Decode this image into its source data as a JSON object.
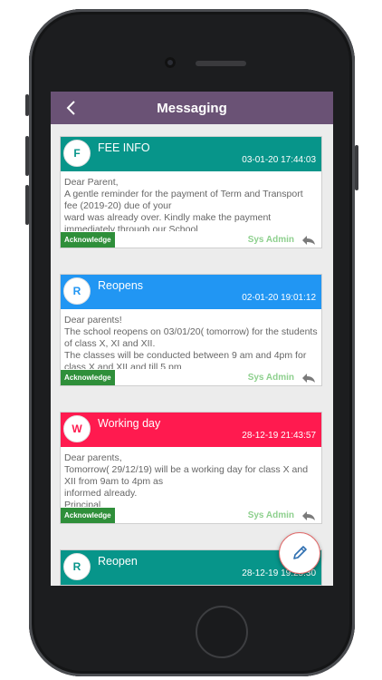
{
  "header": {
    "title": "Messaging"
  },
  "colors": {
    "navbar": "#6a5275",
    "teal": "#07958a",
    "blue": "#2196f3",
    "red": "#ff1a4f",
    "acknowledge": "#2f8f3a",
    "sender": "#8ed08e",
    "fab_border": "#e06b6b"
  },
  "messages": [
    {
      "initial": "F",
      "title": "FEE INFO",
      "date": "03-01-20 17:44:03",
      "color": "#07958a",
      "body": "Dear Parent,\nA gentle reminder for the payment of Term and Transport fee (2019-20) due of your\nward was already over. Kindly make the payment immediately through our School",
      "ack_label": "Acknowledge",
      "sender": "Sys Admin"
    },
    {
      "initial": "R",
      "title": "Reopens",
      "date": "02-01-20 19:01:12",
      "color": "#2196f3",
      "body": "Dear parents!\nThe school reopens on 03/01/20( tomorrow) for the students of class X, XI and XII.\nThe classes will be conducted between 9 am and 4pm for class X and XII and till 5 pm",
      "ack_label": "Acknowledge",
      "sender": "Sys Admin"
    },
    {
      "initial": "W",
      "title": "Working day",
      "date": "28-12-19 21:43:57",
      "color": "#ff1a4f",
      "body": "Dear parents,\nTomorrow( 29/12/19) will be a working day for class X and XII from 9am to 4pm as\ninformed already.\nPrincipal,",
      "ack_label": "Acknowledge",
      "sender": "Sys Admin"
    },
    {
      "initial": "R",
      "title": "Reopen",
      "date": "28-12-19 19:25:30",
      "color": "#07958a"
    }
  ],
  "icons": {
    "back": "chevron-left-icon",
    "reply": "reply-icon",
    "compose": "pencil-icon"
  }
}
